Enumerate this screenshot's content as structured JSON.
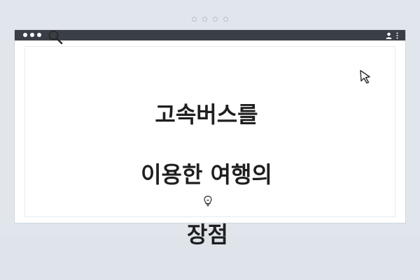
{
  "pager": {
    "dots": 4
  },
  "window": {
    "lights": [
      "close",
      "minimize",
      "maximize"
    ],
    "right_icons": [
      "user-icon",
      "more-vertical-icon"
    ]
  },
  "content": {
    "headline": {
      "line1": "고속버스를",
      "line2": "이용한 여행의",
      "line3": "장점"
    },
    "icons": {
      "top_left": "search-icon",
      "top_right": "cursor-icon",
      "bottom": "lightbulb-icon"
    }
  },
  "colors": {
    "page_bg": "#e1e6ec",
    "titlebar": "#3a3f47",
    "text": "#1f1f1f"
  }
}
